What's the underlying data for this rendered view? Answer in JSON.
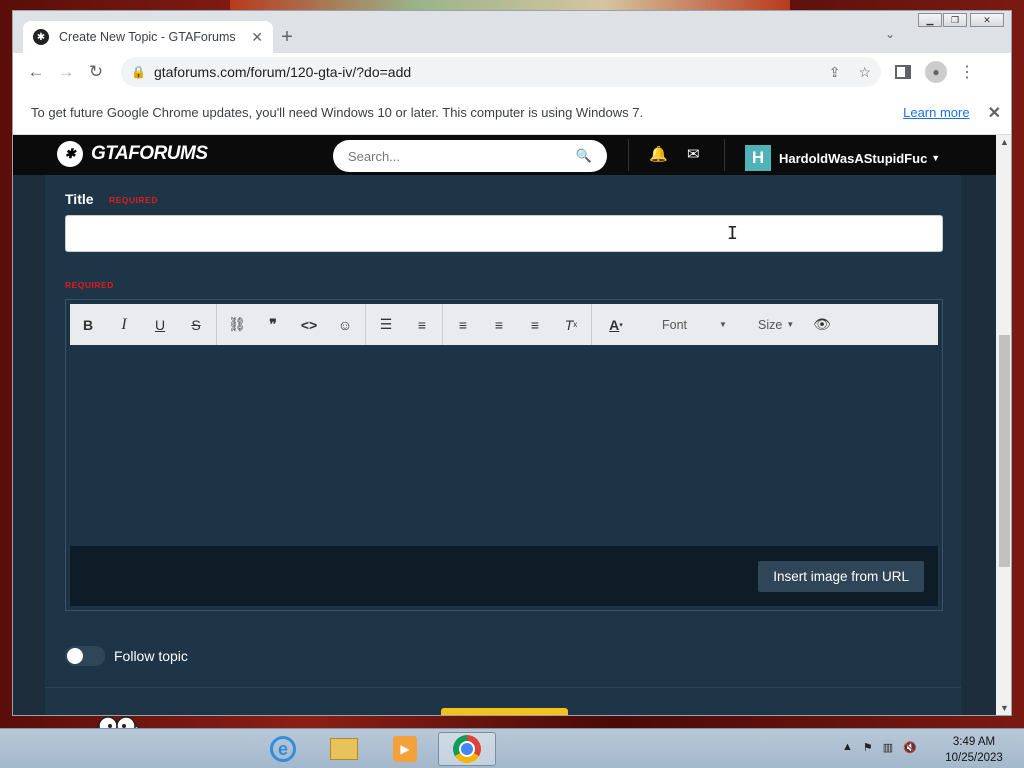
{
  "browser": {
    "tab_title": "Create New Topic - GTAForums",
    "url": "gtaforums.com/forum/120-gta-iv/?do=add",
    "infobar_message": "To get future Google Chrome updates, you'll need Windows 10 or later. This computer is using Windows 7.",
    "infobar_link": "Learn more"
  },
  "site": {
    "logo_text": "GTAFORUMS",
    "search_placeholder": "Search...",
    "user_initial": "H",
    "username": "HardoldWasAStupidFuc"
  },
  "form": {
    "title_label": "Title",
    "title_required": "REQUIRED",
    "title_value": "",
    "content_required": "REQUIRED",
    "toolbar": {
      "font_label": "Font",
      "size_label": "Size"
    },
    "insert_image_label": "Insert image from URL",
    "follow_label": "Follow topic",
    "follow_on": false
  },
  "taskbar": {
    "time": "3:49 AM",
    "date": "10/25/2023"
  },
  "colors": {
    "page_bg": "#1d2d3c",
    "panel_bg": "#1e3447",
    "required": "#e11b1b",
    "submit": "#f4c319"
  }
}
